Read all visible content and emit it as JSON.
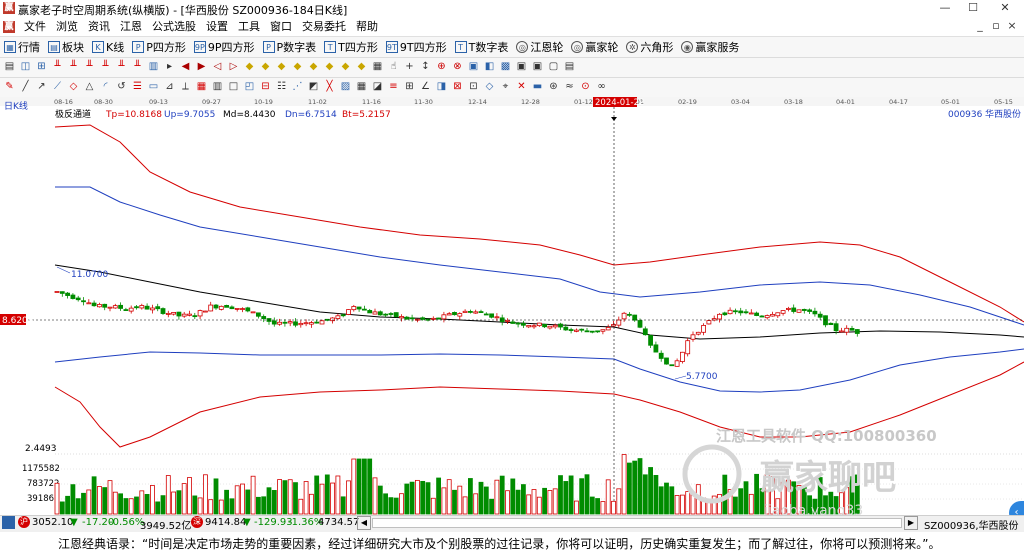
{
  "window": {
    "title": "赢家老子时空周期系统(纵横版) - [华西股份  SZ000936-184日K线]",
    "min_glyph": "—",
    "max_glyph": "☐",
    "close_glyph": "✕"
  },
  "menubar": {
    "logo": "赢",
    "items": [
      "文件",
      "浏览",
      "资讯",
      "江恩",
      "公式选股",
      "设置",
      "工具",
      "窗口",
      "交易委托",
      "帮助"
    ],
    "win_controls": [
      "_",
      "▫",
      "×"
    ]
  },
  "toolbar1": {
    "items": [
      {
        "icon": "grid-icon",
        "glyph": "▦",
        "label": "行情"
      },
      {
        "icon": "blocks-icon",
        "glyph": "▤",
        "label": "板块"
      },
      {
        "icon": "kline-icon",
        "glyph": "K",
        "label": "K线"
      },
      {
        "icon": "p-square-icon",
        "glyph": "P",
        "label": "P四方形"
      },
      {
        "icon": "9p-square-icon",
        "glyph": "9P",
        "label": "9P四方形"
      },
      {
        "icon": "p-digit-icon",
        "glyph": "P",
        "label": "P数字表"
      },
      {
        "icon": "t-square-icon",
        "glyph": "T",
        "label": "T四方形"
      },
      {
        "icon": "9t-square-icon",
        "glyph": "9T",
        "label": "9T四方形"
      },
      {
        "icon": "t-digit-icon",
        "glyph": "T",
        "label": "T数字表"
      },
      {
        "icon": "gann-wheel-icon",
        "glyph": "◎",
        "label": "江恩轮"
      },
      {
        "icon": "winner-wheel-icon",
        "glyph": "◎",
        "label": "赢家轮"
      },
      {
        "icon": "hexagon-icon",
        "glyph": "✲",
        "label": "六角形"
      },
      {
        "icon": "service-icon",
        "glyph": "◉",
        "label": "赢家服务"
      }
    ]
  },
  "chart": {
    "period_label": "日K线",
    "indicator_name": "极反通道",
    "params": [
      {
        "text": "Tp=10.8168",
        "color": "#d40000"
      },
      {
        "text": "Up=9.7055",
        "color": "#1f3fbf"
      },
      {
        "text": "Md=8.4430",
        "color": "#000000"
      },
      {
        "text": "Dn=6.7514",
        "color": "#1f3fbf"
      },
      {
        "text": "Bt=5.2157",
        "color": "#d40000"
      }
    ],
    "stock_code": "000936",
    "stock_name": "华西股份",
    "date_ticks": [
      "08-16",
      "08-30",
      "09-13",
      "09-27",
      "10-19",
      "11-02",
      "11-16",
      "11-30",
      "12-14",
      "12-28",
      "01-12",
      "02-01",
      "02-19",
      "03-04",
      "03-18",
      "04-01",
      "04-17",
      "05-01",
      "05-15"
    ],
    "cursor_date": "2024-01-22",
    "high_label": "11.0700",
    "low_label": "5.7700",
    "current_price_label": "8.6208",
    "bottom_price_label": "2.4493",
    "volume_labels": [
      "1175582",
      "783722",
      "391861"
    ],
    "watermark_line1": "江恩工具软件  QQ:100800360",
    "watermark_logo": "赢家聊吧",
    "watermark_url": "jiaoba.yang33"
  },
  "chart_data": {
    "type": "candlestick",
    "title": "华西股份 SZ000936 日K线",
    "ylabel": "",
    "price_range_visible": [
      5.77,
      11.07
    ],
    "channel_values": {
      "Tp": 10.8168,
      "Up": 9.7055,
      "Md": 8.443,
      "Dn": 6.7514,
      "Bt": 5.2157
    },
    "series": [
      {
        "name": "Tp",
        "color": "#d40000"
      },
      {
        "name": "Up",
        "color": "#1f3fbf"
      },
      {
        "name": "Md",
        "color": "#000000"
      },
      {
        "name": "Dn",
        "color": "#1f3fbf"
      },
      {
        "name": "Bt",
        "color": "#d40000"
      }
    ],
    "high": 11.07,
    "low": 5.77,
    "last_price": 8.6208,
    "volume_axis": [
      391861,
      783722,
      1175582
    ]
  },
  "status": {
    "sh_index": "3052.10",
    "sh_change": "-17.20",
    "sh_pct": "-0.56%",
    "sh_amount": "3949.52亿",
    "sz_index": "9414.84",
    "sz_change": "-129.93",
    "sz_pct": "-1.36%",
    "sz_amount": "4734.57",
    "right_code": "SZ000936,华西股份"
  },
  "quote": {
    "text": "江恩经典语录：“时间是决定市场走势的重要因素，经过详细研究大市及个别股票的过往记录，你将可以证明，历史确实重复发生；而了解过往，你将可以预测将来。”。"
  },
  "colors": {
    "up_candle": "#d40000",
    "down_candle": "#008c00",
    "channel_outer": "#d40000",
    "channel_inner": "#1f3fbf",
    "mid_line": "#000000",
    "accent_blue": "#2e86de"
  }
}
